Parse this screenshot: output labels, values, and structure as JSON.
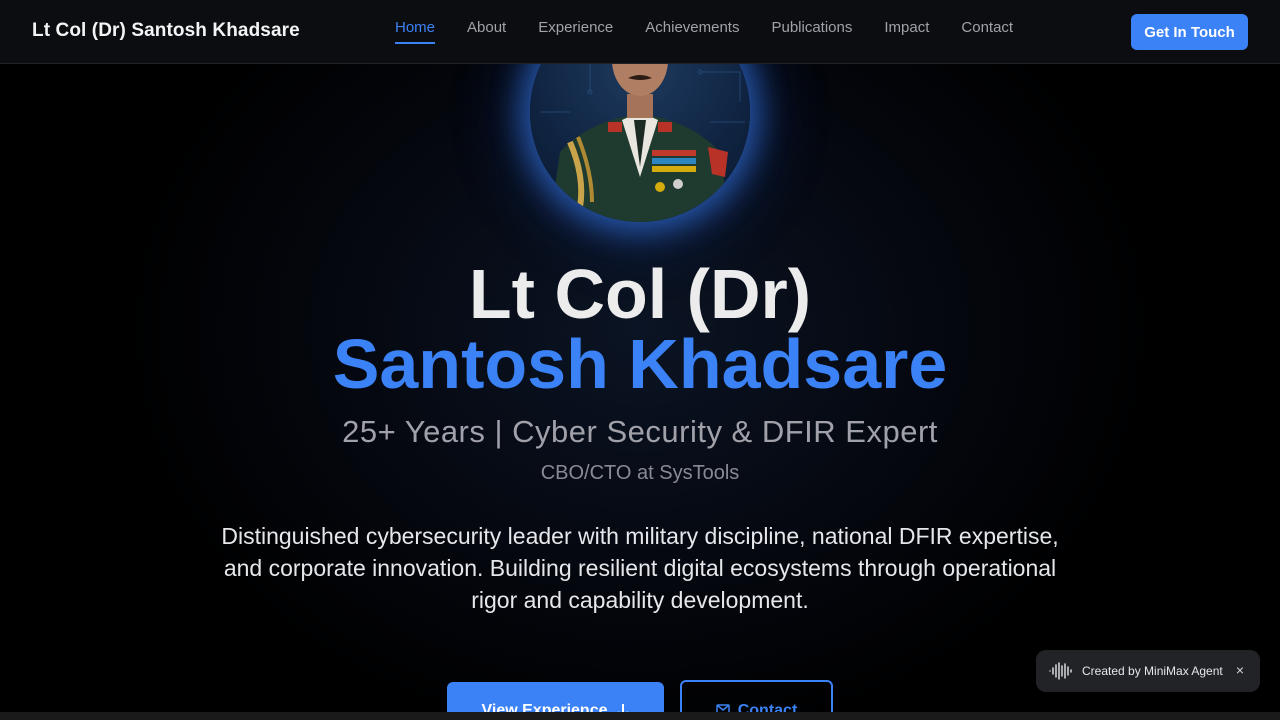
{
  "nav": {
    "brand": "Lt Col (Dr) Santosh Khadsare",
    "links": [
      {
        "label": "Home",
        "active": true
      },
      {
        "label": "About"
      },
      {
        "label": "Experience"
      },
      {
        "label": "Achievements"
      },
      {
        "label": "Publications"
      },
      {
        "label": "Impact"
      },
      {
        "label": "Contact"
      }
    ],
    "cta": "Get In Touch"
  },
  "hero": {
    "line1": "Lt Col (Dr)",
    "line2": "Santosh Khadsare",
    "subtitle": "25+ Years | Cyber Security & DFIR Expert",
    "role": "CBO/CTO at SysTools",
    "description": "Distinguished cybersecurity leader with military discipline, national DFIR expertise, and corporate innovation. Building resilient digital ecosystems through operational rigor and capability development.",
    "primary_button": "View Experience",
    "secondary_button": "Contact"
  },
  "badge": {
    "text": "Created by MiniMax Agent",
    "close": "×"
  },
  "colors": {
    "accent": "#3b82f6",
    "background": "#000000",
    "nav_bg": "#0c0d10"
  },
  "icons": {
    "primary_button_icon": "arrow-down-icon",
    "secondary_button_icon": "mail-icon",
    "badge_icon": "waveform-icon"
  }
}
